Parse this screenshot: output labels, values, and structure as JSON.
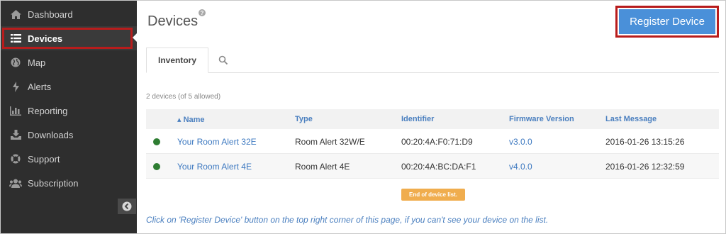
{
  "sidebar": {
    "items": [
      {
        "label": "Dashboard",
        "icon": "home-icon"
      },
      {
        "label": "Devices",
        "icon": "list-icon"
      },
      {
        "label": "Map",
        "icon": "globe-icon"
      },
      {
        "label": "Alerts",
        "icon": "bolt-icon"
      },
      {
        "label": "Reporting",
        "icon": "bar-chart-icon"
      },
      {
        "label": "Downloads",
        "icon": "download-icon"
      },
      {
        "label": "Support",
        "icon": "life-ring-icon"
      },
      {
        "label": "Subscription",
        "icon": "users-icon"
      }
    ],
    "active": "Devices"
  },
  "header": {
    "title": "Devices",
    "register_label": "Register Device"
  },
  "tabs": [
    {
      "label": "Inventory",
      "active": true
    }
  ],
  "summary": "2 devices (of 5 allowed)",
  "table": {
    "columns": [
      "▴ Name",
      "Type",
      "Identifier",
      "Firmware Version",
      "Last Message"
    ],
    "rows": [
      {
        "status": "online",
        "name": "Your Room Alert 32E",
        "type": "Room Alert 32W/E",
        "identifier": "00:20:4A:F0:71:D9",
        "firmware": "v3.0.0",
        "last_message": "2016-01-26 13:15:26"
      },
      {
        "status": "online",
        "name": "Your Room Alert 4E",
        "type": "Room Alert 4E",
        "identifier": "00:20:4A:BC:DA:F1",
        "firmware": "v4.0.0",
        "last_message": "2016-01-26 12:32:59"
      }
    ]
  },
  "end_label": "End of device list.",
  "footer_note": "Click on 'Register Device' button on the top right corner of this page, if you can't see your device on the list.",
  "colors": {
    "sidebar_bg": "#2e2e2e",
    "accent_button": "#4a90d9",
    "highlight_border": "#b81c1c",
    "status_online": "#2e7d32",
    "badge": "#f0ad4e"
  }
}
